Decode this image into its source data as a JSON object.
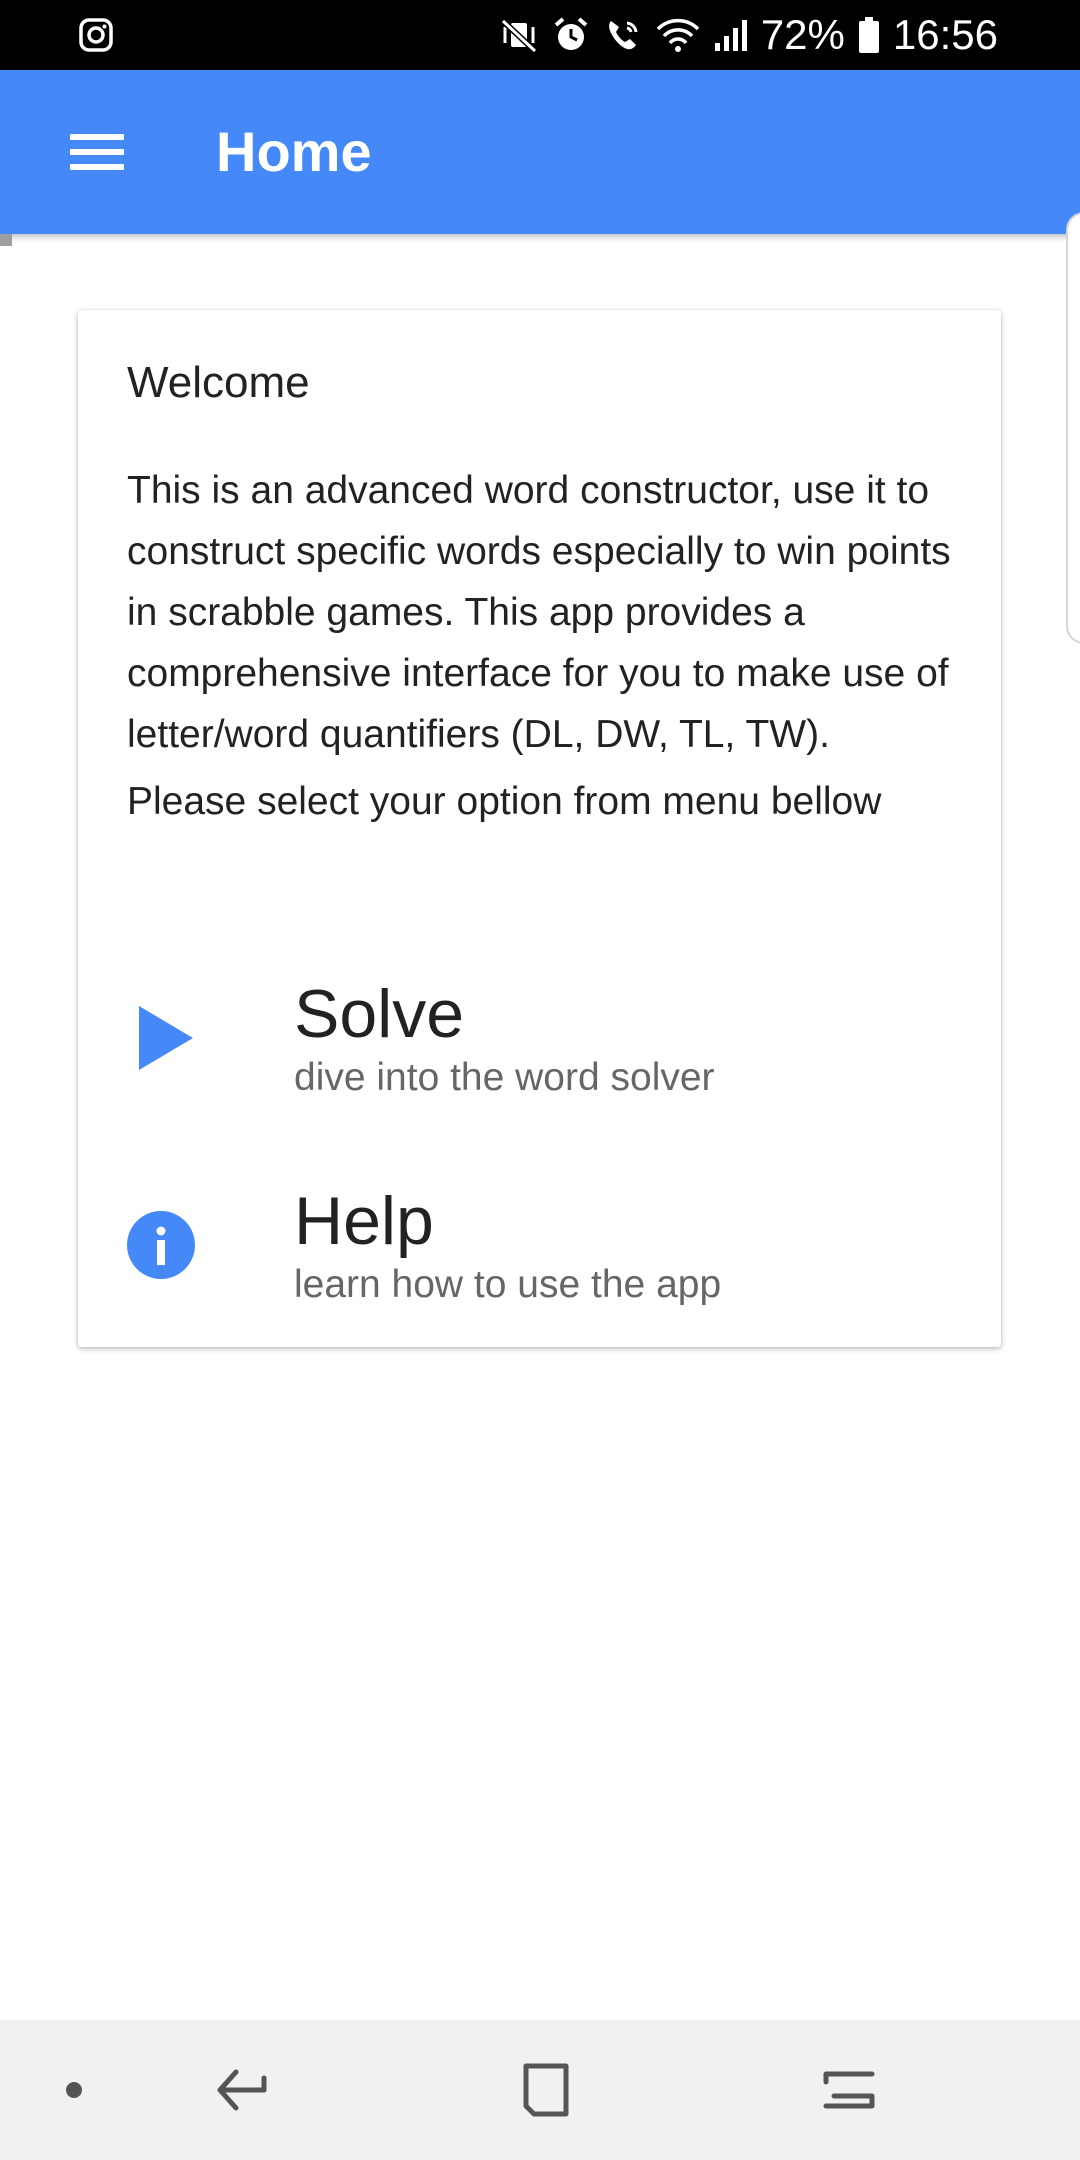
{
  "status_bar": {
    "battery_percent": "72%",
    "time": "16:56",
    "icons": [
      "instagram-icon",
      "mute-vibrate-icon",
      "alarm-icon",
      "wifi-call-icon",
      "wifi-icon",
      "signal-icon",
      "battery-icon"
    ]
  },
  "app_bar": {
    "title": "Home",
    "menu_icon": "hamburger-menu-icon",
    "color": "#4489f7"
  },
  "card": {
    "title": "Welcome",
    "paragraph1": "This is an advanced word constructor, use it to construct specific words especially to win points in scrabble games. This app provides a comprehensive interface for you to make use of letter/word quantifiers (DL, DW, TL, TW).",
    "paragraph2": "Please select your option from menu bellow",
    "items": [
      {
        "title": "Solve",
        "subtitle": "dive into the word solver",
        "icon": "play-icon"
      },
      {
        "title": "Help",
        "subtitle": "learn how to use the app",
        "icon": "info-icon"
      }
    ]
  },
  "nav_bar": {
    "buttons": [
      "dot-icon",
      "back-icon",
      "home-icon",
      "recents-icon"
    ]
  }
}
